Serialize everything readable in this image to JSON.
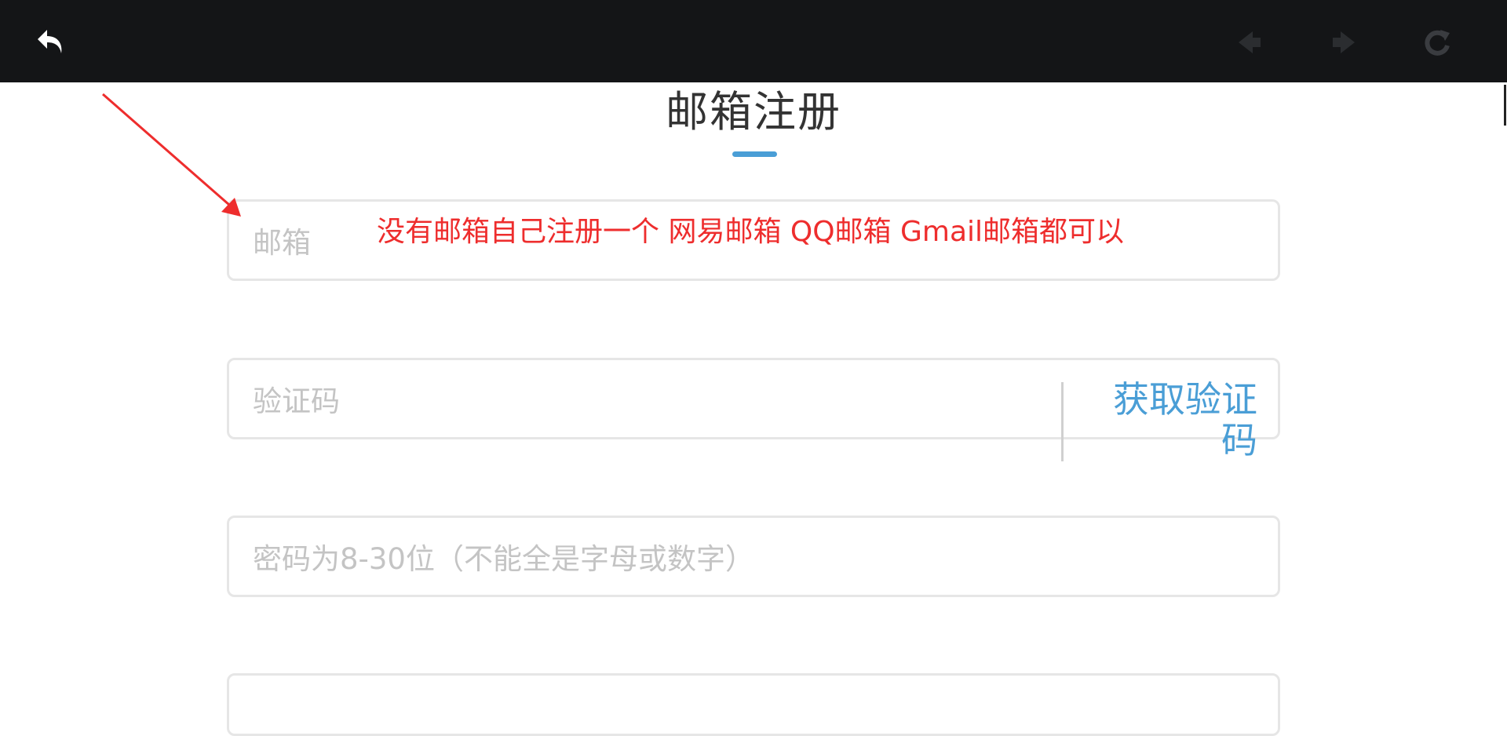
{
  "toolbar": {
    "icons": [
      "back-icon",
      "prev-icon",
      "next-icon",
      "reload-icon"
    ]
  },
  "form": {
    "title": "邮箱注册",
    "email_placeholder": "邮箱",
    "code_placeholder": "验证码",
    "get_code_label": "获取验证码",
    "password_placeholder": "密码为8-30位（不能全是字母或数字）"
  },
  "annotation": {
    "text": "没有邮箱自己注册一个 网易邮箱 QQ邮箱 Gmail邮箱都可以"
  },
  "colors": {
    "topbar": "#141517",
    "accent": "#4a9ed6",
    "annotation": "#ee2d2d",
    "placeholder": "#c4c4c4"
  }
}
